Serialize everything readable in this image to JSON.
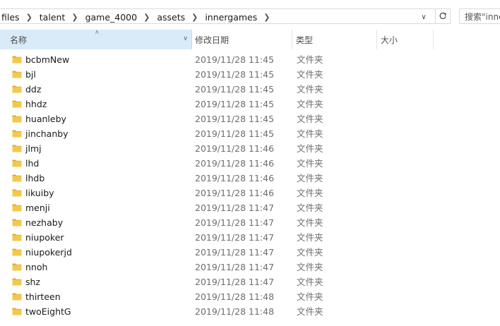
{
  "address_bar": {
    "crumbs": [
      "files",
      "talent",
      "game_4000",
      "assets",
      "innergames"
    ]
  },
  "search": {
    "placeholder": "搜索\"inne"
  },
  "columns": {
    "name": "名称",
    "date": "修改日期",
    "type": "类型",
    "size": "大小"
  },
  "files": [
    {
      "name": "bcbmNew",
      "date": "2019/11/28 11:45",
      "type": "文件夹"
    },
    {
      "name": "bjl",
      "date": "2019/11/28 11:45",
      "type": "文件夹"
    },
    {
      "name": "ddz",
      "date": "2019/11/28 11:45",
      "type": "文件夹"
    },
    {
      "name": "hhdz",
      "date": "2019/11/28 11:45",
      "type": "文件夹"
    },
    {
      "name": "huanleby",
      "date": "2019/11/28 11:45",
      "type": "文件夹"
    },
    {
      "name": "jinchanby",
      "date": "2019/11/28 11:45",
      "type": "文件夹"
    },
    {
      "name": "jlmj",
      "date": "2019/11/28 11:46",
      "type": "文件夹"
    },
    {
      "name": "lhd",
      "date": "2019/11/28 11:46",
      "type": "文件夹"
    },
    {
      "name": "lhdb",
      "date": "2019/11/28 11:46",
      "type": "文件夹"
    },
    {
      "name": "likuiby",
      "date": "2019/11/28 11:46",
      "type": "文件夹"
    },
    {
      "name": "menji",
      "date": "2019/11/28 11:47",
      "type": "文件夹"
    },
    {
      "name": "nezhaby",
      "date": "2019/11/28 11:47",
      "type": "文件夹"
    },
    {
      "name": "niupoker",
      "date": "2019/11/28 11:47",
      "type": "文件夹"
    },
    {
      "name": "niupokerjd",
      "date": "2019/11/28 11:47",
      "type": "文件夹"
    },
    {
      "name": "nnoh",
      "date": "2019/11/28 11:47",
      "type": "文件夹"
    },
    {
      "name": "shz",
      "date": "2019/11/28 11:47",
      "type": "文件夹"
    },
    {
      "name": "thirteen",
      "date": "2019/11/28 11:48",
      "type": "文件夹"
    },
    {
      "name": "twoEightG",
      "date": "2019/11/28 11:48",
      "type": "文件夹"
    }
  ],
  "colors": {
    "folder": "#f2c94c",
    "folder_dark": "#dcaa2e",
    "header_selected": "#d9ebf9"
  },
  "icons": {
    "folder": "folder-icon",
    "refresh": "refresh-icon",
    "dropdown": "chevron-down-icon",
    "breadcrumb_sep": "chevron-right-icon"
  }
}
